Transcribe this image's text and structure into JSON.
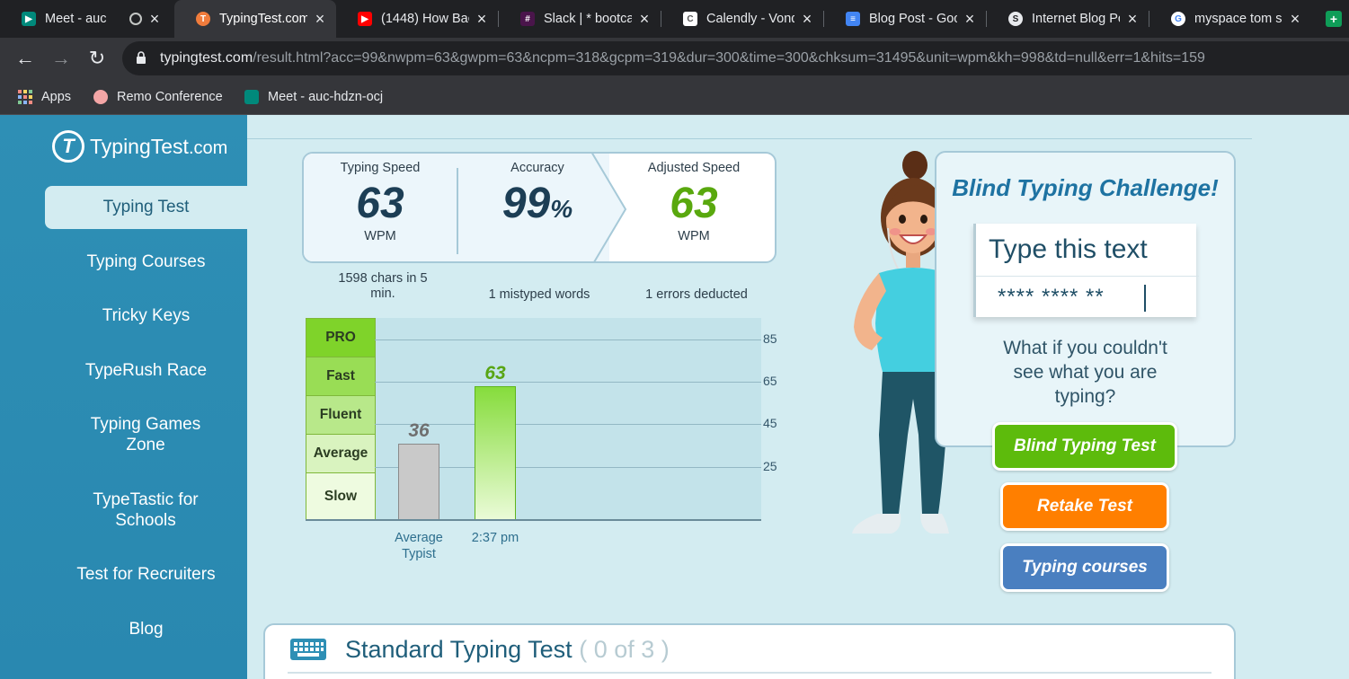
{
  "browser": {
    "tabs": [
      {
        "title": "Meet - auc",
        "favicon": "google-meet-icon",
        "color": "#00897b"
      },
      {
        "title": "TypingTest.com",
        "favicon": "typingtest-icon",
        "color": "#f07c3c"
      },
      {
        "title": "(1448) How Bac",
        "favicon": "youtube-icon",
        "color": "#ff0000"
      },
      {
        "title": "Slack | * bootca",
        "favicon": "slack-icon",
        "color": "#4a154b"
      },
      {
        "title": "Calendly - Vond",
        "favicon": "calendly-icon",
        "color": "#ffffff"
      },
      {
        "title": "Blog Post - Goo",
        "favicon": "google-docs-icon",
        "color": "#4285f4"
      },
      {
        "title": "Internet Blog Po",
        "favicon": "skillshare-icon",
        "color": "#e8eaed"
      },
      {
        "title": "myspace tom s",
        "favicon": "google-icon",
        "color": "#ffffff"
      }
    ],
    "url_host": "typingtest.com",
    "url_path": "/result.html?acc=99&nwpm=63&gwpm=63&ncpm=318&gcpm=319&dur=300&time=300&chksum=31495&unit=wpm&kh=998&td=null&err=1&hits=159",
    "bookmarks": [
      {
        "label": "Apps",
        "icon": "apps-grid-icon"
      },
      {
        "label": "Remo Conference",
        "icon": "remo-icon"
      },
      {
        "label": "Meet - auc-hdzn-ocj",
        "icon": "google-meet-icon"
      }
    ]
  },
  "site": {
    "logo_text": "TypingTest",
    "logo_suffix": ".com",
    "nav": [
      "Typing Test",
      "Typing Courses",
      "Tricky Keys",
      "TypeRush Race",
      "Typing Games Zone",
      "TypeTastic for Schools",
      "Test for Recruiters",
      "Blog"
    ],
    "active_nav": "Typing Test"
  },
  "results": {
    "typing_speed": {
      "label": "Typing Speed",
      "value": "63",
      "unit": "WPM"
    },
    "accuracy": {
      "label": "Accuracy",
      "value": "99",
      "unit": "%"
    },
    "adjusted_speed": {
      "label": "Adjusted Speed",
      "value": "63",
      "unit": "WPM"
    },
    "chars_note": "1598 chars in 5 min.",
    "mistyped_note": "1 mistyped words",
    "errors_note": "1 errors deducted"
  },
  "chart_data": {
    "type": "bar",
    "categories": [
      "Average Typist",
      "2:37 pm"
    ],
    "values": [
      36,
      63
    ],
    "yticks": [
      25,
      45,
      65,
      85
    ],
    "ylim": [
      0,
      95
    ],
    "bands": [
      "PRO",
      "Fast",
      "Fluent",
      "Average",
      "Slow"
    ],
    "band_colors": [
      "#7fd32a",
      "#99dd55",
      "#b8e88a",
      "#d9f3bf",
      "#eefbe0"
    ],
    "bar_colors": [
      "#c9c9c9",
      "#b9ef8f"
    ],
    "label_colors": [
      "#6f6f6f",
      "#58a514"
    ],
    "grid": true
  },
  "challenge": {
    "title": "Blind Typing Challenge!",
    "type_box_title": "Type this text",
    "masked_text": "**** **** **",
    "question": "What if you couldn't see what you are typing?"
  },
  "buttons": {
    "blind": {
      "label": "Blind Typing Test",
      "color": "#5dbb0c"
    },
    "retake": {
      "label": "Retake Test",
      "color": "#ff7f00"
    },
    "courses": {
      "label": "Typing courses",
      "color": "#4a7fc0"
    }
  },
  "standard_test": {
    "title": "Standard Typing Test",
    "count": "( 0 of 3 )"
  },
  "colors": {
    "accent": "#1e73a2",
    "adjusted_value": "#59a80e",
    "sidebar": "#2e8fb5"
  }
}
